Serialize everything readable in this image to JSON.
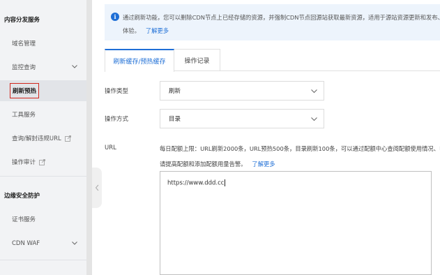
{
  "sidebar": {
    "section1": "内容分发服务",
    "items": [
      {
        "label": "域名管理"
      },
      {
        "label": "监控查询"
      },
      {
        "label": "刷新预热"
      },
      {
        "label": "工具服务"
      },
      {
        "label": "查询/解封违规URL"
      },
      {
        "label": "操作审计"
      }
    ],
    "section2": "边缘安全防护",
    "items2": [
      {
        "label": "证书服务"
      },
      {
        "label": "CDN WAF"
      }
    ]
  },
  "notice": {
    "line1": "通过刷新功能，您可以删除CDN节点上已经存储的资源，并强制CDN节点回源站获取最新资源，适用于源站资源更新和发布、违",
    "line2": "体验。",
    "link": "了解更多"
  },
  "tabs": [
    {
      "label": "刷新缓存/预热缓存"
    },
    {
      "label": "操作记录"
    }
  ],
  "form": {
    "op_type_label": "操作类型",
    "op_type_value": "刷新",
    "op_method_label": "操作方式",
    "op_method_value": "目录",
    "url_label": "URL",
    "hint_line1": "每日配额上限：URL刷新2000条，URL预热500条，目录刷新100条，可以通过配额中心查阅配额使用情况、申",
    "hint_line2": "请提高配额和添加配额用量告警。",
    "hint_link": "了解更多",
    "url_value": "https://www.ddd.cc"
  },
  "colors": {
    "accent": "#1f6fd6",
    "highlight_border": "#d0261c",
    "notice_bg": "#edf4fc",
    "sidebar_bg": "#f2f3f5"
  }
}
